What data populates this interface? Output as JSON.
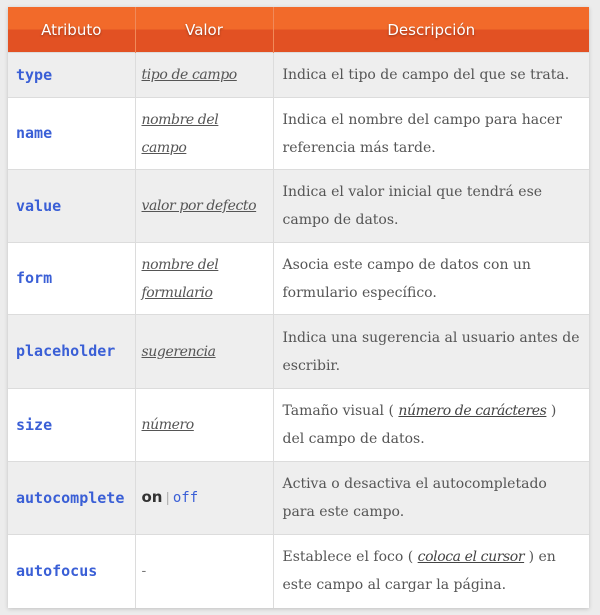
{
  "table": {
    "headers": [
      "Atributo",
      "Valor",
      "Descripción"
    ],
    "rows": [
      {
        "attr": "type",
        "value": "tipo de campo",
        "desc": "Indica el tipo de campo del que se trata."
      },
      {
        "attr": "name",
        "value": "nombre del campo",
        "desc": "Indica el nombre del campo para hacer referencia más tarde."
      },
      {
        "attr": "value",
        "value": "valor por defecto",
        "desc": "Indica el valor inicial que tendrá ese campo de datos."
      },
      {
        "attr": "form",
        "value": "nombre del formulario",
        "desc": "Asocia este campo de datos con un formulario específico."
      },
      {
        "attr": "placeholder",
        "value": "sugerencia",
        "desc": "Indica una sugerencia al usuario antes de escribir."
      },
      {
        "attr": "size",
        "value": "número",
        "desc_pre": "Tamaño visual (",
        "desc_em": "número de carácteres",
        "desc_post": ") del campo de datos."
      },
      {
        "attr": "autocomplete",
        "value_on": "on",
        "value_sep": "|",
        "value_off": "off",
        "desc": "Activa o desactiva el autocompletado para este campo."
      },
      {
        "attr": "autofocus",
        "value_dash": "-",
        "desc_pre": "Establece el foco (",
        "desc_em": "coloca el cursor",
        "desc_post": ") en este campo al cargar la página."
      }
    ]
  },
  "colors": {
    "header_top": "#f26a2a",
    "header_bottom": "#e25123",
    "attr_blue": "#3a5fd6",
    "row_alt": "#eeeeee"
  }
}
